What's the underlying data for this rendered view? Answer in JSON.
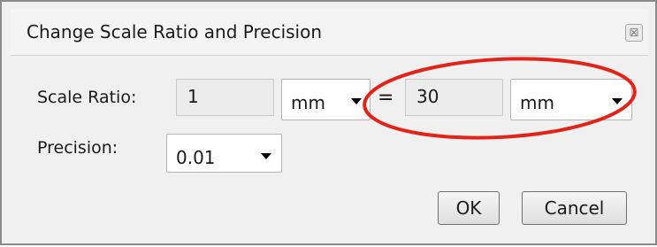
{
  "dialog": {
    "title": "Change Scale Ratio and Precision",
    "close_glyph": "☒"
  },
  "scale_ratio": {
    "label": "Scale Ratio:",
    "left_value": "1",
    "left_unit": "mm",
    "equals": "=",
    "right_value": "30",
    "right_unit": "mm"
  },
  "precision": {
    "label": "Precision:",
    "value": "0.01"
  },
  "buttons": {
    "ok": "OK",
    "cancel": "Cancel"
  },
  "annotation": {
    "highlight_color": "#e2231a"
  },
  "icons": [
    "close-icon",
    "dropdown-arrow-icon"
  ]
}
